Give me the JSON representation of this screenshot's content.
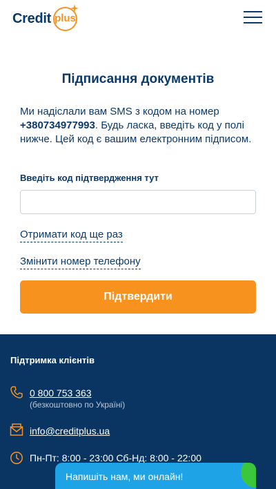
{
  "header": {
    "logo_word": "Credit",
    "logo_badge": "plus",
    "menu_icon": "hamburger-menu-icon"
  },
  "page": {
    "title": "Підписання документів",
    "info_prefix": "Ми надіслали вам SMS з кодом на номер ",
    "phone_number": "+380734977993",
    "info_suffix": ". Будь ласка, введіть код у полі нижче. Цей код є вашим електронним підписом.",
    "code_label": "Введіть код підтвердження тут",
    "code_value": "",
    "resend_link": "Отримати код ще раз",
    "change_phone_link": "Змінити номер телефону",
    "confirm_button": "Підтвердити"
  },
  "footer": {
    "title": "Підтримка клієнтів",
    "phone": "0 800 753 363",
    "phone_note": "(безкоштовно по Україні)",
    "email": "info@creditplus.ua",
    "hours": "Пн-Пт: 8:00 - 23:00 Сб-Нд: 8:00 - 22:00",
    "icons": [
      "phone-icon",
      "mail-icon",
      "clock-icon"
    ]
  },
  "chat": {
    "label": "Напишіть нам, ми онлайн!"
  },
  "colors": {
    "brand_navy": "#0a3a6b",
    "accent_orange": "#f7921e",
    "footer_bg": "#0a3562",
    "chat_blue": "#1ea3e6",
    "online_green": "#3cc63c"
  }
}
